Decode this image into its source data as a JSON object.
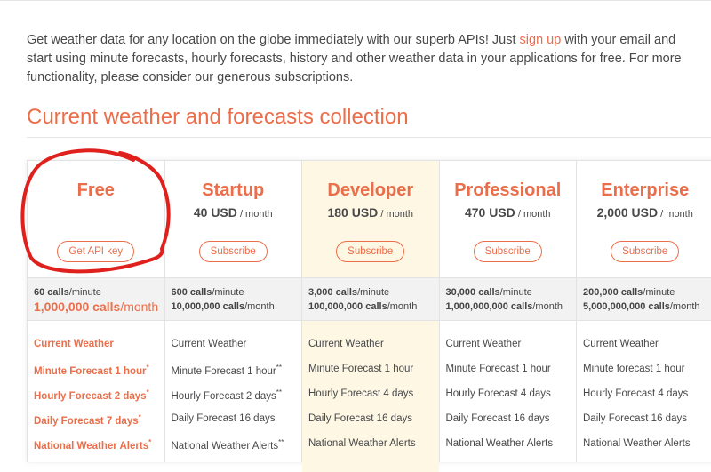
{
  "intro": {
    "before": "Get weather data for any location on the globe immediately with our superb APIs! Just ",
    "link": "sign up",
    "after": " with your email and start using minute forecasts, hourly forecasts, history and other weather data in your applications for free. For more functionality, please consider our generous subscriptions."
  },
  "section_title": "Current weather and forecasts collection",
  "plans": [
    {
      "name": "Free",
      "price": "",
      "unit": "",
      "button": "Get API key",
      "calls_min": "60 calls",
      "calls_min_unit": "/minute",
      "calls_month": "1,000,000 calls",
      "calls_month_unit": "/month",
      "features": [
        [
          "Current Weather",
          ""
        ],
        [
          "Minute Forecast 1 hour",
          "*"
        ],
        [
          "Hourly Forecast 2 days",
          "*"
        ],
        [
          "Daily Forecast 7 days",
          "*"
        ],
        [
          "National Weather Alerts",
          "*"
        ]
      ]
    },
    {
      "name": "Startup",
      "price": "40 USD",
      "unit": " / month",
      "button": "Subscribe",
      "calls_min": "600 calls",
      "calls_min_unit": "/minute",
      "calls_month": "10,000,000 calls",
      "calls_month_unit": "/month",
      "features": [
        [
          "Current Weather",
          ""
        ],
        [
          "Minute Forecast 1 hour",
          "**"
        ],
        [
          "Hourly Forecast 2 days",
          "**"
        ],
        [
          "Daily Forecast 16 days",
          ""
        ],
        [
          "National Weather Alerts",
          "**"
        ]
      ]
    },
    {
      "name": "Developer",
      "price": "180 USD",
      "unit": " / month",
      "button": "Subscribe",
      "calls_min": "3,000 calls",
      "calls_min_unit": "/minute",
      "calls_month": "100,000,000 calls",
      "calls_month_unit": "/month",
      "features": [
        [
          "Current Weather",
          ""
        ],
        [
          "Minute Forecast 1 hour",
          ""
        ],
        [
          "Hourly Forecast 4 days",
          ""
        ],
        [
          "Daily Forecast 16 days",
          ""
        ],
        [
          "National Weather Alerts",
          ""
        ]
      ]
    },
    {
      "name": "Professional",
      "price": "470 USD",
      "unit": " / month",
      "button": "Subscribe",
      "calls_min": "30,000 calls",
      "calls_min_unit": "/minute",
      "calls_month": "1,000,000,000 calls",
      "calls_month_unit": "/month",
      "features": [
        [
          "Current Weather",
          ""
        ],
        [
          "Minute Forecast 1 hour",
          ""
        ],
        [
          "Hourly Forecast 4 days",
          ""
        ],
        [
          "Daily Forecast 16 days",
          ""
        ],
        [
          "National Weather Alerts",
          ""
        ]
      ]
    },
    {
      "name": "Enterprise",
      "price": "2,000 USD",
      "unit": " / month",
      "button": "Subscribe",
      "calls_min": "200,000 calls",
      "calls_min_unit": "/minute",
      "calls_month": "5,000,000,000 calls",
      "calls_month_unit": "/month",
      "features": [
        [
          "Current Weather",
          ""
        ],
        [
          "Minute forecast 1 hour",
          ""
        ],
        [
          "Hourly Forecast 4 days",
          ""
        ],
        [
          "Daily Forecast 16 days",
          ""
        ],
        [
          "National Weather Alerts",
          ""
        ]
      ]
    }
  ],
  "colors": {
    "accent": "#eb6e4b",
    "highlight": "#fdf7e4",
    "annotation": "#e0201c"
  }
}
